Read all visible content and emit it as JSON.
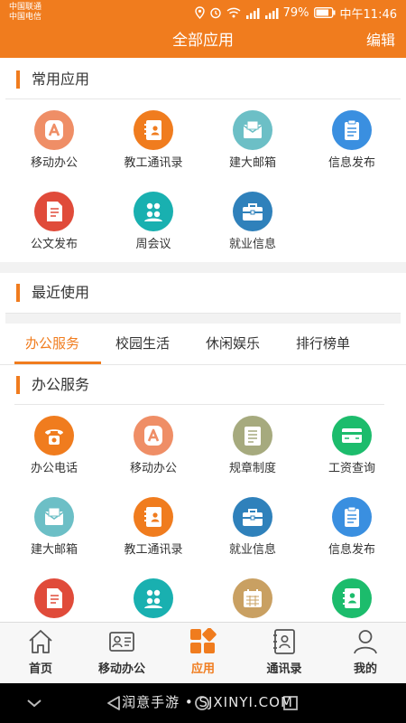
{
  "status_bar": {
    "carrier1": "中国联通",
    "carrier2": "中国电信",
    "signal_badge_1": "2G",
    "signal_badge_2": "4G",
    "battery": "79%",
    "time": "中午11:46"
  },
  "header": {
    "title": "全部应用",
    "edit_label": "编辑"
  },
  "sections": {
    "common": "常用应用",
    "recent": "最近使用",
    "office": "办公服务"
  },
  "common_apps": [
    {
      "label": "移动办公",
      "icon": "mobile-office-icon",
      "color": "#ef8e66"
    },
    {
      "label": "教工通讯录",
      "icon": "staff-directory-icon",
      "color": "#f07c1e"
    },
    {
      "label": "建大邮箱",
      "icon": "mailbox-icon",
      "color": "#6cbfc6"
    },
    {
      "label": "信息发布",
      "icon": "info-publish-icon",
      "color": "#3a8fe0"
    },
    {
      "label": "公文发布",
      "icon": "document-publish-icon",
      "color": "#e04b3a"
    },
    {
      "label": "周会议",
      "icon": "meeting-icon",
      "color": "#19b0b0"
    },
    {
      "label": "就业信息",
      "icon": "employment-icon",
      "color": "#2f81bb"
    }
  ],
  "tabs": [
    {
      "label": "办公服务",
      "active": true
    },
    {
      "label": "校园生活",
      "active": false
    },
    {
      "label": "休闲娱乐",
      "active": false
    },
    {
      "label": "排行榜单",
      "active": false
    }
  ],
  "office_apps": [
    {
      "label": "办公电话",
      "icon": "phone-icon",
      "color": "#f07c1e"
    },
    {
      "label": "移动办公",
      "icon": "mobile-office-icon",
      "color": "#ef8e66"
    },
    {
      "label": "规章制度",
      "icon": "regulations-icon",
      "color": "#a6aa7e"
    },
    {
      "label": "工资查询",
      "icon": "salary-card-icon",
      "color": "#1cbc6c"
    },
    {
      "label": "建大邮箱",
      "icon": "mailbox-icon",
      "color": "#6cbfc6"
    },
    {
      "label": "教工通讯录",
      "icon": "staff-directory-icon",
      "color": "#f07c1e"
    },
    {
      "label": "就业信息",
      "icon": "employment-icon",
      "color": "#2f81bb"
    },
    {
      "label": "信息发布",
      "icon": "info-publish-icon",
      "color": "#3a8fe0"
    },
    {
      "label": "",
      "icon": "document-publish-icon",
      "color": "#e04b3a"
    },
    {
      "label": "",
      "icon": "meeting-icon",
      "color": "#19b0b0"
    },
    {
      "label": "",
      "icon": "calendar-icon",
      "color": "#c9a062"
    },
    {
      "label": "",
      "icon": "contact-book-icon",
      "color": "#1cbc6c"
    }
  ],
  "bottom_nav": [
    {
      "label": "首页",
      "icon": "home-icon",
      "active": false
    },
    {
      "label": "移动办公",
      "icon": "id-card-icon",
      "active": false
    },
    {
      "label": "应用",
      "icon": "apps-grid-icon",
      "active": true
    },
    {
      "label": "通讯录",
      "icon": "address-book-icon",
      "active": false
    },
    {
      "label": "我的",
      "icon": "person-icon",
      "active": false
    }
  ],
  "watermark": "润意手游 • SJXINYI.COM",
  "accent_color": "#f07c1e"
}
